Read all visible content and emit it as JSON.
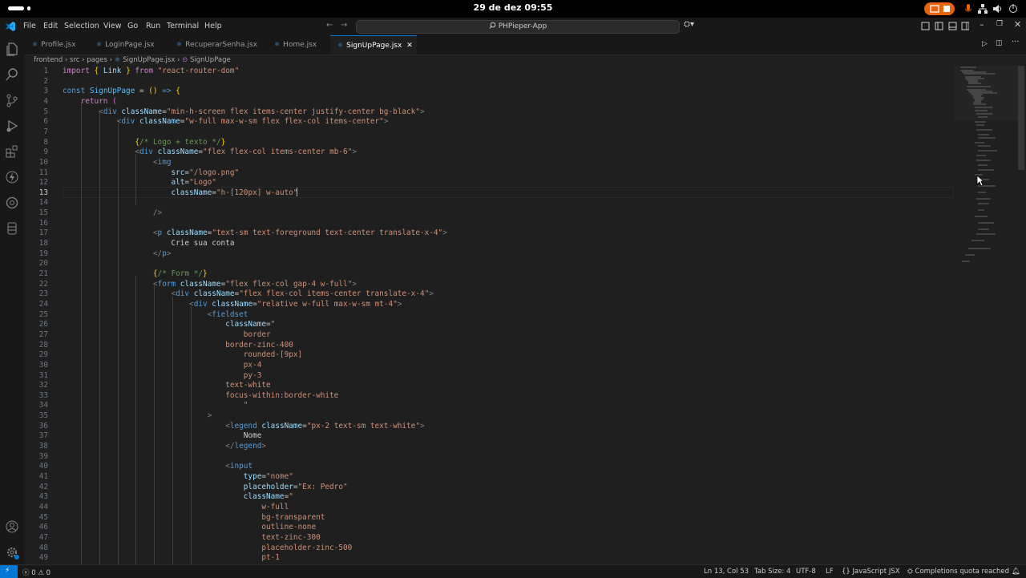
{
  "system": {
    "clock": "29 de dez  09:55"
  },
  "menu": [
    "File",
    "Edit",
    "Selection",
    "View",
    "Go",
    "Run",
    "Terminal",
    "Help"
  ],
  "search": {
    "label": "PHPieper-App"
  },
  "tabs": [
    {
      "label": "Profile.jsx",
      "active": false
    },
    {
      "label": "LoginPage.jsx",
      "active": false
    },
    {
      "label": "RecuperarSenha.jsx",
      "active": false
    },
    {
      "label": "Home.jsx",
      "active": false
    },
    {
      "label": "SignUpPage.jsx",
      "active": true
    }
  ],
  "tab_icon": "jsx",
  "breadcrumb": [
    "frontend",
    "src",
    "pages",
    "SignUpPage.jsx",
    "SignUpPage"
  ],
  "editor": {
    "current_line": 13,
    "lines": [
      [
        [
          "kw2",
          "import"
        ],
        [
          "t",
          " "
        ],
        [
          "br",
          "{"
        ],
        [
          "t",
          " "
        ],
        [
          "attr",
          "Link"
        ],
        [
          "t",
          " "
        ],
        [
          "br",
          "}"
        ],
        [
          "t",
          " "
        ],
        [
          "kw2",
          "from"
        ],
        [
          "t",
          " "
        ],
        [
          "str",
          "\"react-router-dom\""
        ]
      ],
      [],
      [
        [
          "kw",
          "const"
        ],
        [
          "t",
          " "
        ],
        [
          "fn",
          "SignUpPage"
        ],
        [
          "t",
          " = "
        ],
        [
          "br",
          "()"
        ],
        [
          "t",
          " "
        ],
        [
          "kw",
          "=>"
        ],
        [
          "t",
          " "
        ],
        [
          "br",
          "{"
        ]
      ],
      [
        [
          "t",
          "    "
        ],
        [
          "kw2",
          "return"
        ],
        [
          "t",
          " "
        ],
        [
          "br2",
          "("
        ]
      ],
      [
        [
          "t",
          "        "
        ],
        [
          "pun",
          "<"
        ],
        [
          "tag",
          "div"
        ],
        [
          "t",
          " "
        ],
        [
          "attr",
          "className"
        ],
        [
          "t",
          "="
        ],
        [
          "str",
          "\"min-h-screen flex items-center justify-center bg-black\""
        ],
        [
          "pun",
          ">"
        ]
      ],
      [
        [
          "t",
          "            "
        ],
        [
          "pun",
          "<"
        ],
        [
          "tag",
          "div"
        ],
        [
          "t",
          " "
        ],
        [
          "attr",
          "className"
        ],
        [
          "t",
          "="
        ],
        [
          "str",
          "\"w-full max-w-sm flex flex-col items-center\""
        ],
        [
          "pun",
          ">"
        ]
      ],
      [],
      [
        [
          "t",
          "                "
        ],
        [
          "br",
          "{"
        ],
        [
          "cm",
          "/* Logo + texto */"
        ],
        [
          "br",
          "}"
        ]
      ],
      [
        [
          "t",
          "                "
        ],
        [
          "pun",
          "<"
        ],
        [
          "tag",
          "div"
        ],
        [
          "t",
          " "
        ],
        [
          "attr",
          "className"
        ],
        [
          "t",
          "="
        ],
        [
          "str",
          "\"flex flex-col items-center mb-6\""
        ],
        [
          "pun",
          ">"
        ]
      ],
      [
        [
          "t",
          "                    "
        ],
        [
          "pun",
          "<"
        ],
        [
          "tag",
          "img"
        ]
      ],
      [
        [
          "t",
          "                        "
        ],
        [
          "attr",
          "src"
        ],
        [
          "t",
          "="
        ],
        [
          "str",
          "\"/logo.png\""
        ]
      ],
      [
        [
          "t",
          "                        "
        ],
        [
          "attr",
          "alt"
        ],
        [
          "t",
          "="
        ],
        [
          "str",
          "\"Logo\""
        ]
      ],
      [
        [
          "t",
          "                        "
        ],
        [
          "attr",
          "className"
        ],
        [
          "t",
          "="
        ],
        [
          "str",
          "\"h-[120px] w-auto\""
        ]
      ],
      [],
      [
        [
          "t",
          "                    "
        ],
        [
          "pun",
          "/>"
        ]
      ],
      [],
      [
        [
          "t",
          "                    "
        ],
        [
          "pun",
          "<"
        ],
        [
          "tag",
          "p"
        ],
        [
          "t",
          " "
        ],
        [
          "attr",
          "className"
        ],
        [
          "t",
          "="
        ],
        [
          "str",
          "\"text-sm text-foreground text-center translate-x-4\""
        ],
        [
          "pun",
          ">"
        ]
      ],
      [
        [
          "t",
          "                        Crie sua conta"
        ]
      ],
      [
        [
          "t",
          "                    "
        ],
        [
          "pun",
          "</"
        ],
        [
          "tag",
          "p"
        ],
        [
          "pun",
          ">"
        ]
      ],
      [],
      [
        [
          "t",
          "                    "
        ],
        [
          "br",
          "{"
        ],
        [
          "cm",
          "/* Form */"
        ],
        [
          "br",
          "}"
        ]
      ],
      [
        [
          "t",
          "                    "
        ],
        [
          "pun",
          "<"
        ],
        [
          "tag",
          "form"
        ],
        [
          "t",
          " "
        ],
        [
          "attr",
          "className"
        ],
        [
          "t",
          "="
        ],
        [
          "str",
          "\"flex flex-col gap-4 w-full\""
        ],
        [
          "pun",
          ">"
        ]
      ],
      [
        [
          "t",
          "                        "
        ],
        [
          "pun",
          "<"
        ],
        [
          "tag",
          "div"
        ],
        [
          "t",
          " "
        ],
        [
          "attr",
          "className"
        ],
        [
          "t",
          "="
        ],
        [
          "str",
          "\"flex flex-col items-center translate-x-4\""
        ],
        [
          "pun",
          ">"
        ]
      ],
      [
        [
          "t",
          "                            "
        ],
        [
          "pun",
          "<"
        ],
        [
          "tag",
          "div"
        ],
        [
          "t",
          " "
        ],
        [
          "attr",
          "className"
        ],
        [
          "t",
          "="
        ],
        [
          "str",
          "\"relative w-full max-w-sm mt-4\""
        ],
        [
          "pun",
          ">"
        ]
      ],
      [
        [
          "t",
          "                                "
        ],
        [
          "pun",
          "<"
        ],
        [
          "tag",
          "fieldset"
        ]
      ],
      [
        [
          "t",
          "                                    "
        ],
        [
          "attr",
          "className"
        ],
        [
          "t",
          "="
        ],
        [
          "str",
          "\""
        ]
      ],
      [
        [
          "t",
          "                                        "
        ],
        [
          "str",
          "border"
        ]
      ],
      [
        [
          "t",
          "                                    "
        ],
        [
          "str",
          "border-zinc-400"
        ]
      ],
      [
        [
          "t",
          "                                        "
        ],
        [
          "str",
          "rounded-[9px]"
        ]
      ],
      [
        [
          "t",
          "                                        "
        ],
        [
          "str",
          "px-4"
        ]
      ],
      [
        [
          "t",
          "                                        "
        ],
        [
          "str",
          "py-3"
        ]
      ],
      [
        [
          "t",
          "                                    "
        ],
        [
          "str",
          "text-white"
        ]
      ],
      [
        [
          "t",
          "                                    "
        ],
        [
          "str",
          "focus-within:border-white"
        ]
      ],
      [
        [
          "t",
          "                                        "
        ],
        [
          "str",
          "\""
        ]
      ],
      [
        [
          "t",
          "                                "
        ],
        [
          "pun",
          ">"
        ]
      ],
      [
        [
          "t",
          "                                    "
        ],
        [
          "pun",
          "<"
        ],
        [
          "tag",
          "legend"
        ],
        [
          "t",
          " "
        ],
        [
          "attr",
          "className"
        ],
        [
          "t",
          "="
        ],
        [
          "str",
          "\"px-2 text-sm text-white\""
        ],
        [
          "pun",
          ">"
        ]
      ],
      [
        [
          "t",
          "                                        Nome"
        ]
      ],
      [
        [
          "t",
          "                                    "
        ],
        [
          "pun",
          "</"
        ],
        [
          "tag",
          "legend"
        ],
        [
          "pun",
          ">"
        ]
      ],
      [],
      [
        [
          "t",
          "                                    "
        ],
        [
          "pun",
          "<"
        ],
        [
          "tag",
          "input"
        ]
      ],
      [
        [
          "t",
          "                                        "
        ],
        [
          "attr",
          "type"
        ],
        [
          "t",
          "="
        ],
        [
          "str",
          "\"nome\""
        ]
      ],
      [
        [
          "t",
          "                                        "
        ],
        [
          "attr",
          "placeholder"
        ],
        [
          "t",
          "="
        ],
        [
          "str",
          "\"Ex: Pedro\""
        ]
      ],
      [
        [
          "t",
          "                                        "
        ],
        [
          "attr",
          "className"
        ],
        [
          "t",
          "="
        ],
        [
          "str",
          "\""
        ]
      ],
      [
        [
          "t",
          "                                            "
        ],
        [
          "str",
          "w-full"
        ]
      ],
      [
        [
          "t",
          "                                            "
        ],
        [
          "str",
          "bg-transparent"
        ]
      ],
      [
        [
          "t",
          "                                            "
        ],
        [
          "str",
          "outline-none"
        ]
      ],
      [
        [
          "t",
          "                                            "
        ],
        [
          "str",
          "text-zinc-300"
        ]
      ],
      [
        [
          "t",
          "                                            "
        ],
        [
          "str",
          "placeholder-zinc-500"
        ]
      ],
      [
        [
          "t",
          "                                            "
        ],
        [
          "str",
          "pt-1"
        ]
      ]
    ]
  },
  "status": {
    "problems_errors": "0",
    "problems_warnings": "0",
    "position": "Ln 13, Col 53",
    "tab_size": "Tab Size: 4",
    "encoding": "UTF-8",
    "eol": "LF",
    "language": "JavaScript JSX",
    "copilot": "Completions quota reached"
  },
  "colors": {
    "accent": "#0078d4",
    "editor_bg": "#1f1f1f",
    "chrome_bg": "#181818",
    "recording": "#e8630a"
  }
}
